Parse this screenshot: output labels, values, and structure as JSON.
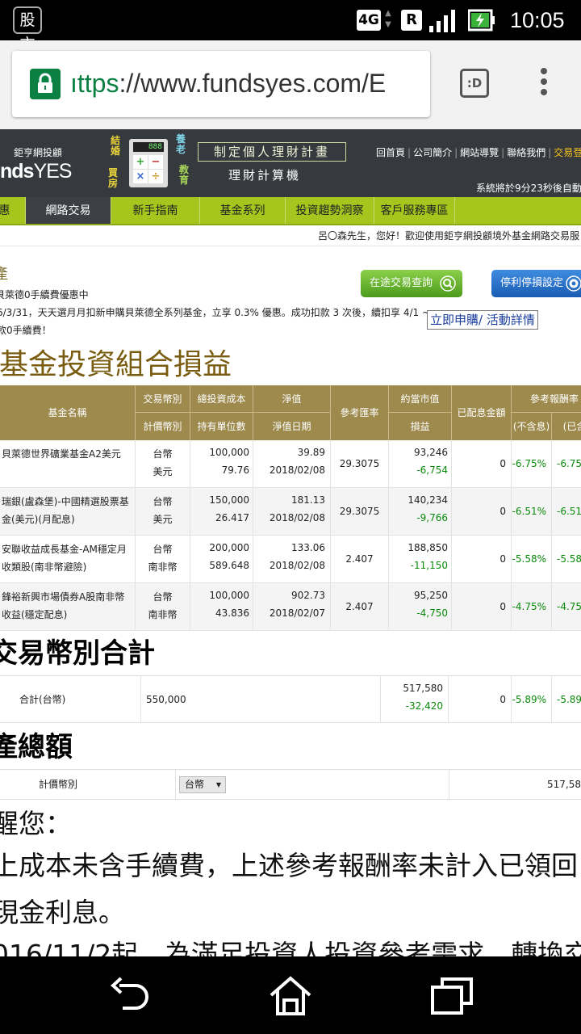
{
  "status_bar": {
    "app_icon_text": "股市",
    "network": "4G",
    "roaming": "R",
    "time": "10:05"
  },
  "browser": {
    "url_scheme": "ıttps",
    "url_rest": "://www.fundsyes.com/E",
    "tab_count_label": ":D"
  },
  "site": {
    "logo_sub": "鉅亨網投顧",
    "logo_main_a": "nds",
    "logo_main_b": "YES",
    "calc_screen": "888",
    "plan_title": "制定個人理財計畫",
    "calc_title": "理財計算機",
    "top_links": [
      "回首頁",
      "公司簡介",
      "網站導覽",
      "聯絡我們",
      "交易登"
    ],
    "countdown": "系統將於9分23秒後自動登",
    "nav": [
      "惠",
      "網路交易",
      "新手指南",
      "基金系列",
      "投資趨勢洞察",
      "客戶服務專區"
    ]
  },
  "welcome": "呂〇森先生，您好！歡迎使用鉅亨網投顧境外基金網路交易服",
  "page_title": "產",
  "buttons": {
    "transit_query": "在途交易查詢",
    "stop_loss": "停利停損設定"
  },
  "promo": {
    "line1": "貝萊德0手續費優惠中",
    "line2": "6/3/31，天天選月月扣新申購貝萊德全系列基金，立享 0.3% 優惠。成功扣款 3 次後，續扣享 4/1 ~",
    "line3": "款0手續費！",
    "link": "立即申購/ 活動詳情"
  },
  "section_title": "-基金投資組合損益",
  "table": {
    "headers": {
      "name": "基金名稱",
      "trade_ccy": "交易幣別",
      "price_ccy": "計價幣別",
      "cost": "總投資成本",
      "units": "持有單位數",
      "nav": "淨值",
      "nav_date": "淨值日期",
      "fx": "參考匯率",
      "market_value": "約當市值",
      "pnl": "損益",
      "dividend": "已配息金額",
      "return": "參考報酬率",
      "return_ex": "(不含息)",
      "return_in": "(已含"
    },
    "rows": [
      {
        "name1": "貝萊德世界礦業基金A2美元",
        "name2": "",
        "trade_ccy": "台幣",
        "price_ccy": "美元",
        "cost": "100,000",
        "units": "79.76",
        "nav": "39.89",
        "nav_date": "2018/02/08",
        "fx": "29.3075",
        "market_value": "93,246",
        "pnl": "-6,754",
        "dividend": "0",
        "ret_ex": "-6.75%",
        "ret_in": "-6.75"
      },
      {
        "name1": "瑞銀(盧森堡)-中國精選股票基",
        "name2": "金(美元)(月配息)",
        "trade_ccy": "台幣",
        "price_ccy": "美元",
        "cost": "150,000",
        "units": "26.417",
        "nav": "181.13",
        "nav_date": "2018/02/08",
        "fx": "29.3075",
        "market_value": "140,234",
        "pnl": "-9,766",
        "dividend": "0",
        "ret_ex": "-6.51%",
        "ret_in": "-6.51"
      },
      {
        "name1": "安聯收益成長基金-AM穩定月",
        "name2": "收類股(南非幣避險)",
        "trade_ccy": "台幣",
        "price_ccy": "南非幣",
        "cost": "200,000",
        "units": "589.648",
        "nav": "133.06",
        "nav_date": "2018/02/08",
        "fx": "2.407",
        "market_value": "188,850",
        "pnl": "-11,150",
        "dividend": "0",
        "ret_ex": "-5.58%",
        "ret_in": "-5.58"
      },
      {
        "name1": "鋒裕新興市場債券A股南非幣",
        "name2": "收益(穩定配息)",
        "trade_ccy": "台幣",
        "price_ccy": "南非幣",
        "cost": "100,000",
        "units": "43.836",
        "nav": "902.73",
        "nav_date": "2018/02/07",
        "fx": "2.407",
        "market_value": "95,250",
        "pnl": "-4,750",
        "dividend": "0",
        "ret_ex": "-4.75%",
        "ret_in": "-4.75"
      }
    ]
  },
  "currency_total": {
    "heading": "交易幣別合計",
    "label": "合計(台幣)",
    "cost": "550,000",
    "market_value": "517,580",
    "pnl": "-32,420",
    "dividend": "0",
    "ret_ex": "-5.89%",
    "ret_in": "-5.89"
  },
  "asset_total": {
    "heading": "產總額",
    "label": "計價幣別",
    "select_value": "台幣",
    "amount": "517,58"
  },
  "notes": {
    "line1": "醒您：",
    "line2": "上成本未含手續費，上述參考報酬率未計入已領回",
    "line3": "現金利息。",
    "line4": "016/11/2起，為滿足投資人投資參考需求，轉換交"
  }
}
